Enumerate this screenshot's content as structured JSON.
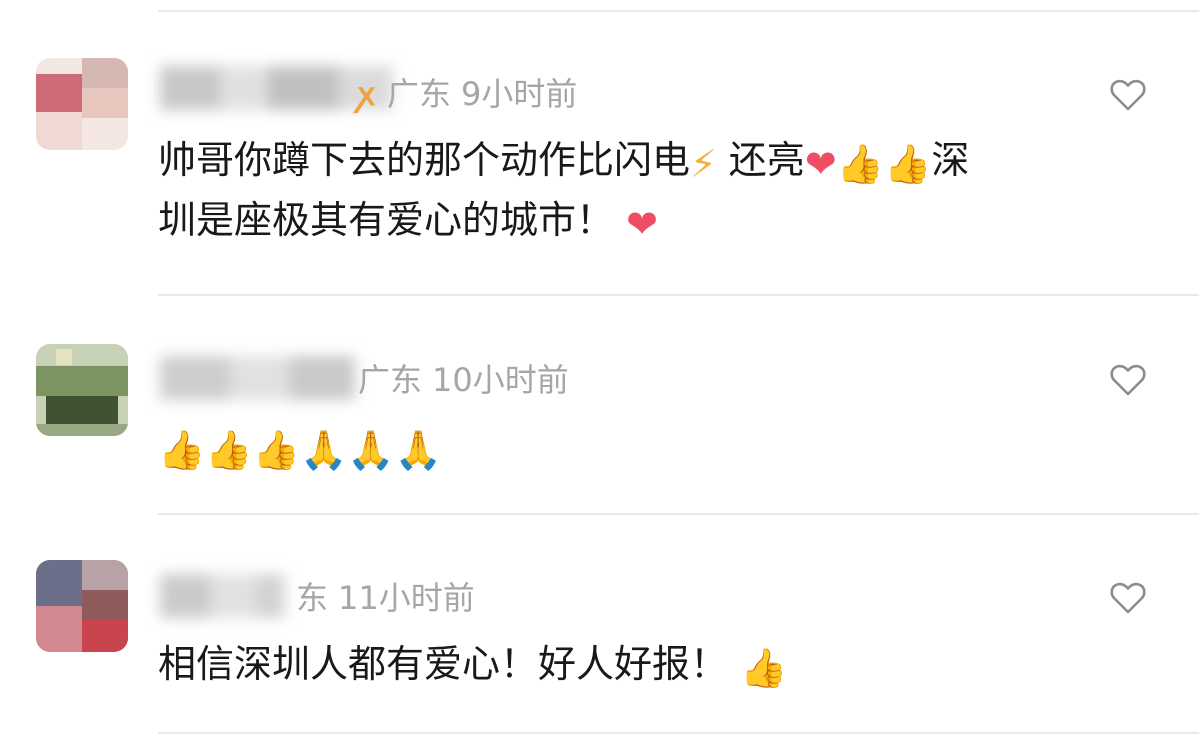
{
  "comments": [
    {
      "badge": "ꭗ",
      "location": "广东",
      "time": "9小时前",
      "text_line1": "帅哥你蹲下去的那个动作比闪电",
      "text_line1b": "还亮",
      "text_line1c": "深",
      "text_line2": "圳是座极其有爱心的城市！",
      "emoji_bolt": "⚡",
      "emoji_heart": "❤",
      "emoji_thumb": "👍"
    },
    {
      "location": "广东",
      "time": "10小时前",
      "emoji_thumb": "👍",
      "emoji_pray": "🙏"
    },
    {
      "location": "东",
      "time": "11小时前",
      "text": "相信深圳人都有爱心！好人好报！",
      "emoji_thumb": "👍"
    }
  ],
  "icons": {
    "like": "heart-outline-icon"
  }
}
